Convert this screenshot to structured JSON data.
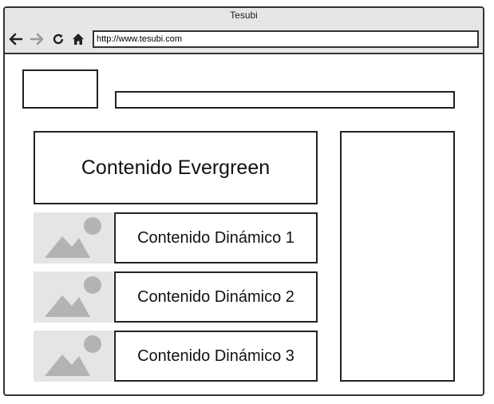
{
  "browser": {
    "title": "Tesubi",
    "url": "http://www.tesubi.com",
    "icons": [
      "back-arrow-icon",
      "forward-arrow-icon",
      "reload-icon",
      "home-icon"
    ]
  },
  "content": {
    "evergreen_label": "Contenido Evergreen",
    "dynamic_items": [
      {
        "label": "Contenido Dinámico 1",
        "thumbnail_icon": "image-placeholder-icon"
      },
      {
        "label": "Contenido Dinámico 2",
        "thumbnail_icon": "image-placeholder-icon"
      },
      {
        "label": "Contenido Dinámico 3",
        "thumbnail_icon": "image-placeholder-icon"
      }
    ]
  },
  "colors": {
    "frame": "#333333",
    "titlebar": "#e6e6e6",
    "placeholder_bg": "#e5e5e5",
    "placeholder_shape": "#b3b3b3"
  }
}
